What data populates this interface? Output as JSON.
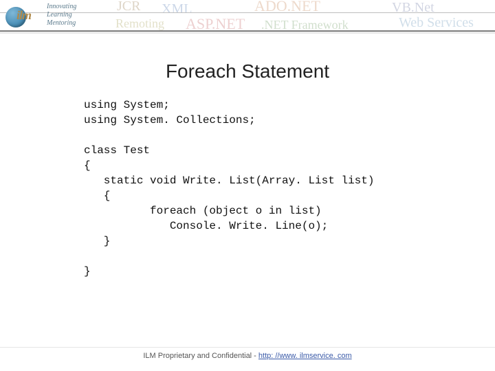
{
  "logo": {
    "text": "ilm",
    "tagline1": "Innovating",
    "tagline2": "Learning",
    "tagline3": "Mentoring"
  },
  "backgroundWords": {
    "w1": "JCR",
    "w2": "XML",
    "w3": "ADO.NET",
    "w4": "VB.Net",
    "w5": "Remoting",
    "w6": "ASP.NET",
    "w7": ".NET Framework",
    "w8": "Web Services"
  },
  "title": "Foreach Statement",
  "code": "using System;\nusing System. Collections;\n\nclass Test\n{\n   static void Write. List(Array. List list)\n   {\n          foreach (object o in list)\n             Console. Write. Line(o);\n   }\n\n}",
  "footer": {
    "prefix": "ILM Proprietary and Confidential - ",
    "linkText": "http: //www. ilmservice. com",
    "linkHref": "http://www.ilmservice.com"
  }
}
